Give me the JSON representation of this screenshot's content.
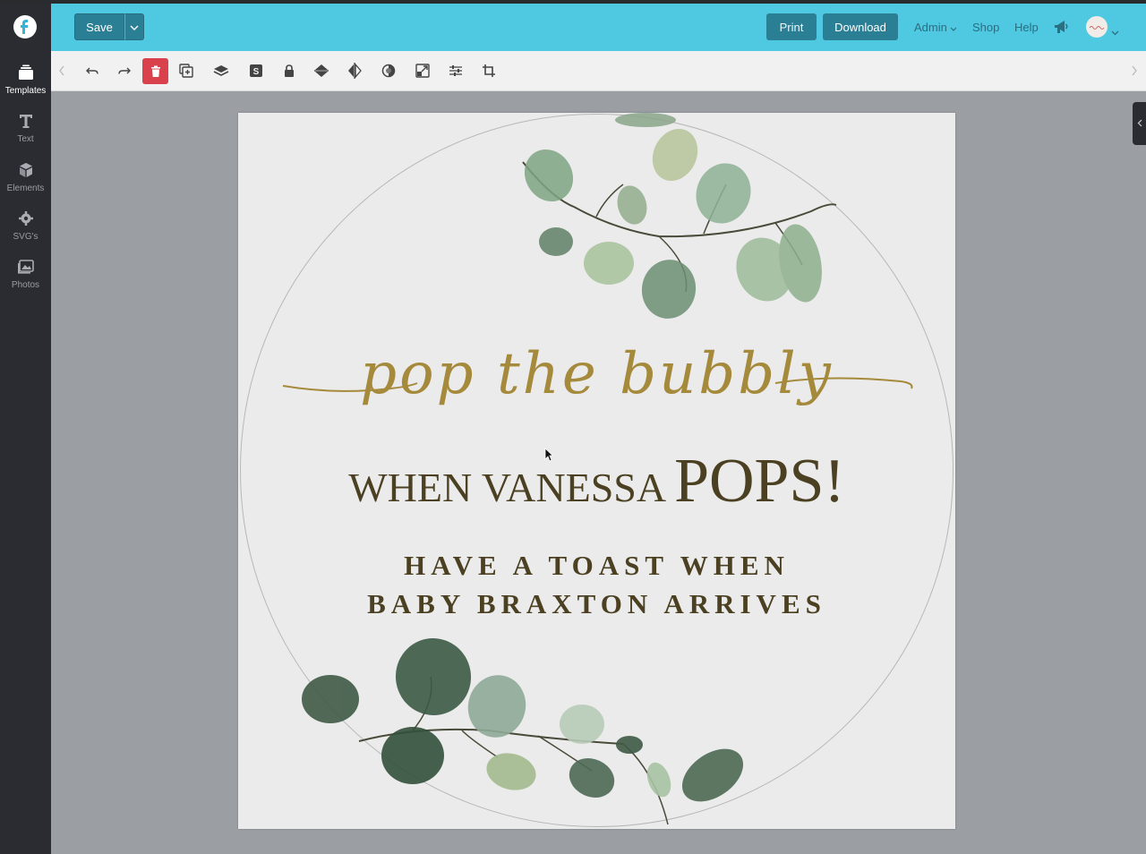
{
  "sidebar": {
    "items": [
      {
        "label": "Templates",
        "icon": "templates-icon"
      },
      {
        "label": "Text",
        "icon": "text-icon"
      },
      {
        "label": "Elements",
        "icon": "elements-icon"
      },
      {
        "label": "SVG's",
        "icon": "gear-icon"
      },
      {
        "label": "Photos",
        "icon": "photos-icon"
      }
    ]
  },
  "header": {
    "save_label": "Save",
    "print_label": "Print",
    "download_label": "Download",
    "admin_label": "Admin",
    "shop_label": "Shop",
    "help_label": "Help"
  },
  "toolbar": {
    "tools": [
      "undo-icon",
      "redo-icon",
      "delete-icon",
      "duplicate-icon",
      "layers-icon",
      "svg-icon",
      "lock-icon",
      "align-icon",
      "flip-icon",
      "opacity-icon",
      "resize-icon",
      "adjust-icon",
      "crop-icon"
    ]
  },
  "design": {
    "script_title": "pop the bubbly",
    "line1_small": "WHEN VANESSA ",
    "line1_big": "POPS!",
    "line2": "HAVE A TOAST WHEN",
    "line3": "BABY BRAXTON ARRIVES"
  },
  "colors": {
    "header": "#4fc8e2",
    "button": "#2b7f95",
    "sidebar": "#2b2c31",
    "gold_script": "#a58a3c",
    "body_text": "#4b4122",
    "delete": "#d9424c"
  }
}
